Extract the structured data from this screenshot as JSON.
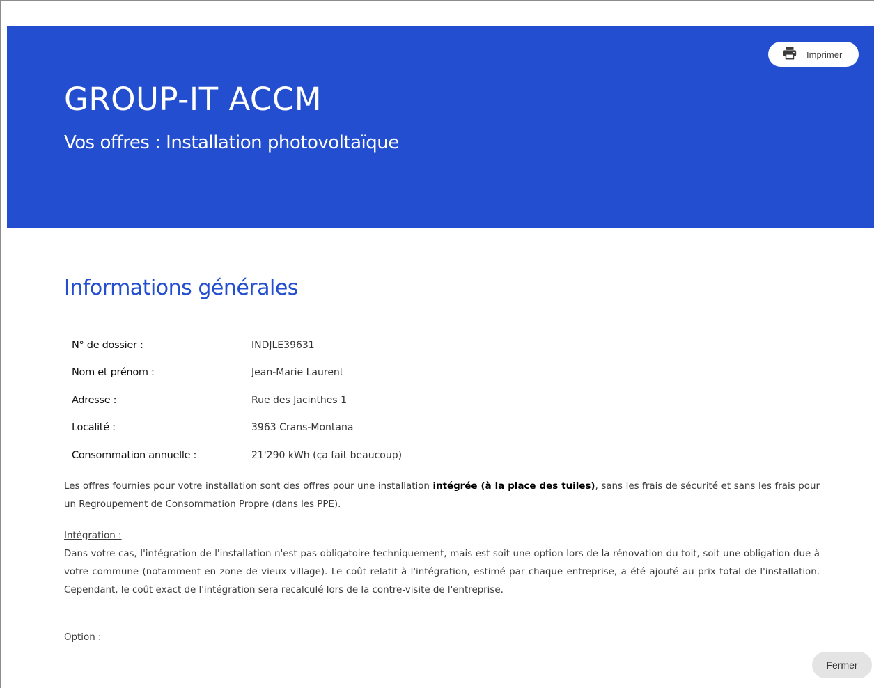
{
  "header": {
    "print_label": "Imprimer",
    "company": "GROUP-IT ACCM",
    "subtitle": "Vos offres : Installation photovoltaïque",
    "background_color": "#234ecf"
  },
  "general_info": {
    "title": "Informations générales",
    "rows": [
      {
        "label": "N° de dossier :",
        "value": "INDJLE39631"
      },
      {
        "label": "Nom et prénom :",
        "value": "Jean-Marie Laurent"
      },
      {
        "label": "Adresse :",
        "value": "Rue des Jacinthes 1"
      },
      {
        "label": "Localité :",
        "value": "3963 Crans-Montana"
      },
      {
        "label": "Consommation annuelle :",
        "value": "21'290 kWh (ça fait beaucoup)"
      }
    ]
  },
  "offers_note": {
    "before": "Les offres fournies pour votre installation sont des offres pour une installation ",
    "bold": "intégrée (à la place des tuiles)",
    "after": ", sans les frais de sécurité et sans les frais pour un Regroupement de Consommation Propre (dans les PPE)."
  },
  "integration": {
    "title": "Intégration :",
    "text": "Dans votre cas, l'intégration de l'installation n'est pas obligatoire techniquement, mais est soit une option lors de la rénovation du toit, soit une obligation due à votre commune (notamment en zone de vieux village). Le coût relatif à l'intégration, estimé par chaque entreprise, a été ajouté au prix total de l'installation. Cependant, le coût exact de l'intégration sera recalculé lors de la contre-visite de l'entreprise."
  },
  "option": {
    "title": "Option :"
  },
  "footer": {
    "close_label": "Fermer"
  }
}
